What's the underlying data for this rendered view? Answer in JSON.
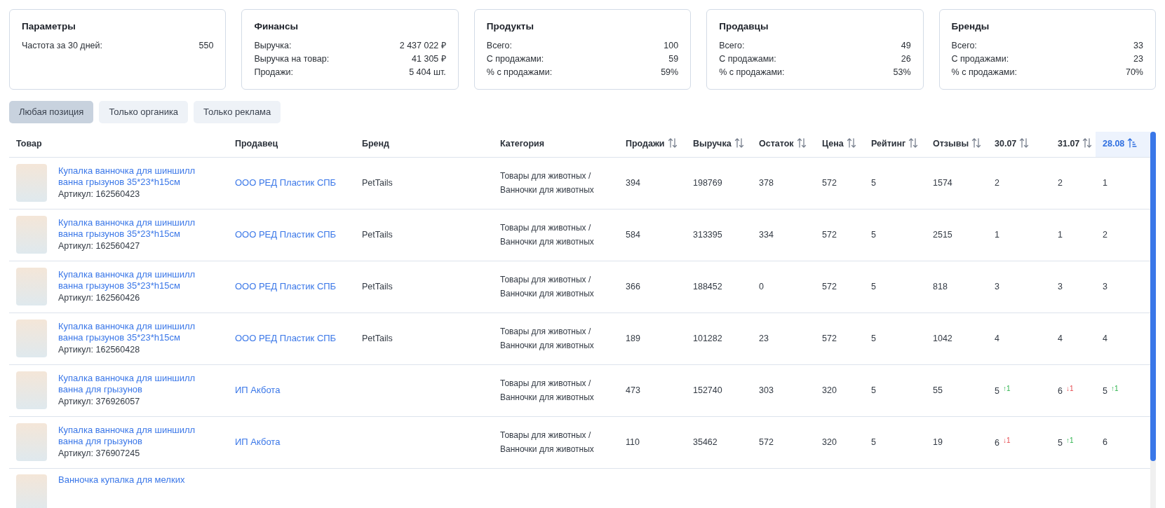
{
  "summary_cards": [
    {
      "title": "Параметры",
      "rows": [
        {
          "label": "Частота за 30 дней:",
          "value": "550"
        }
      ]
    },
    {
      "title": "Финансы",
      "rows": [
        {
          "label": "Выручка:",
          "value": "2 437 022 ₽"
        },
        {
          "label": "Выручка на товар:",
          "value": "41 305 ₽"
        },
        {
          "label": "Продажи:",
          "value": "5 404 шт."
        }
      ]
    },
    {
      "title": "Продукты",
      "rows": [
        {
          "label": "Всего:",
          "value": "100"
        },
        {
          "label": "С продажами:",
          "value": "59"
        },
        {
          "label": "% с продажами:",
          "value": "59%"
        }
      ]
    },
    {
      "title": "Продавцы",
      "rows": [
        {
          "label": "Всего:",
          "value": "49"
        },
        {
          "label": "С продажами:",
          "value": "26"
        },
        {
          "label": "% с продажами:",
          "value": "53%"
        }
      ]
    },
    {
      "title": "Бренды",
      "rows": [
        {
          "label": "Всего:",
          "value": "33"
        },
        {
          "label": "С продажами:",
          "value": "23"
        },
        {
          "label": "% с продажами:",
          "value": "70%"
        }
      ]
    }
  ],
  "position_filters": [
    {
      "label": "Любая позиция",
      "selected": true
    },
    {
      "label": "Только органика",
      "selected": false
    },
    {
      "label": "Только реклама",
      "selected": false
    }
  ],
  "table": {
    "columns": [
      {
        "label": "Товар",
        "sortable": false,
        "sorted": false
      },
      {
        "label": "Продавец",
        "sortable": false,
        "sorted": false
      },
      {
        "label": "Бренд",
        "sortable": false,
        "sorted": false
      },
      {
        "label": "Категория",
        "sortable": false,
        "sorted": false
      },
      {
        "label": "Продажи",
        "sortable": true,
        "sorted": false
      },
      {
        "label": "Выручка",
        "sortable": true,
        "sorted": false
      },
      {
        "label": "Остаток",
        "sortable": true,
        "sorted": false
      },
      {
        "label": "Цена",
        "sortable": true,
        "sorted": false
      },
      {
        "label": "Рейтинг",
        "sortable": true,
        "sorted": false
      },
      {
        "label": "Отзывы",
        "sortable": true,
        "sorted": false
      },
      {
        "label": "30.07",
        "sortable": true,
        "sorted": false
      },
      {
        "label": "31.07",
        "sortable": true,
        "sorted": false
      },
      {
        "label": "28.08",
        "sortable": true,
        "sorted": true
      }
    ],
    "rows": [
      {
        "title": "Купалка ванночка для шиншилл ванна грызунов 35*23*h15см",
        "article": "Артикул: 162560423",
        "seller": "ООО РЕД Пластик СПБ",
        "brand": "PetTails",
        "category": "Товары для животных / Ванночки для животных",
        "sales": "394",
        "revenue": "198769",
        "stock": "378",
        "price": "572",
        "rating": "5",
        "reviews": "1574",
        "positions": [
          {
            "value": "2"
          },
          {
            "value": "2"
          },
          {
            "value": "1"
          }
        ]
      },
      {
        "title": "Купалка ванночка для шиншилл ванна грызунов 35*23*h15см",
        "article": "Артикул: 162560427",
        "seller": "ООО РЕД Пластик СПБ",
        "brand": "PetTails",
        "category": "Товары для животных / Ванночки для животных",
        "sales": "584",
        "revenue": "313395",
        "stock": "334",
        "price": "572",
        "rating": "5",
        "reviews": "2515",
        "positions": [
          {
            "value": "1"
          },
          {
            "value": "1"
          },
          {
            "value": "2"
          }
        ]
      },
      {
        "title": "Купалка ванночка для шиншилл ванна грызунов 35*23*h15см",
        "article": "Артикул: 162560426",
        "seller": "ООО РЕД Пластик СПБ",
        "brand": "PetTails",
        "category": "Товары для животных / Ванночки для животных",
        "sales": "366",
        "revenue": "188452",
        "stock": "0",
        "price": "572",
        "rating": "5",
        "reviews": "818",
        "positions": [
          {
            "value": "3"
          },
          {
            "value": "3"
          },
          {
            "value": "3"
          }
        ]
      },
      {
        "title": "Купалка ванночка для шиншилл ванна грызунов 35*23*h15см",
        "article": "Артикул: 162560428",
        "seller": "ООО РЕД Пластик СПБ",
        "brand": "PetTails",
        "category": "Товары для животных / Ванночки для животных",
        "sales": "189",
        "revenue": "101282",
        "stock": "23",
        "price": "572",
        "rating": "5",
        "reviews": "1042",
        "positions": [
          {
            "value": "4"
          },
          {
            "value": "4"
          },
          {
            "value": "4"
          }
        ]
      },
      {
        "title": "Купалка ванночка для шиншилл ванна для грызунов",
        "article": "Артикул: 376926057",
        "seller": "ИП Акбота",
        "category": "Товары для животных / Ванночки для животных",
        "sales": "473",
        "revenue": "152740",
        "stock": "303",
        "price": "320",
        "rating": "5",
        "reviews": "55",
        "positions": [
          {
            "value": "5",
            "change": "↑1",
            "rising": true
          },
          {
            "value": "6",
            "change": "↓1",
            "rising": false
          },
          {
            "value": "5",
            "change": "↑1",
            "rising": true
          }
        ]
      },
      {
        "title": "Купалка ванночка для шиншилл ванна для грызунов",
        "article": "Артикул: 376907245",
        "seller": "ИП Акбота",
        "category": "Товары для животных / Ванночки для животных",
        "sales": "110",
        "revenue": "35462",
        "stock": "572",
        "price": "320",
        "rating": "5",
        "reviews": "19",
        "positions": [
          {
            "value": "6",
            "change": "↓1",
            "rising": false
          },
          {
            "value": "5",
            "change": "↑1",
            "rising": true
          },
          {
            "value": "6"
          }
        ]
      },
      {
        "title": "Ванночка купалка для мелких"
      }
    ]
  }
}
